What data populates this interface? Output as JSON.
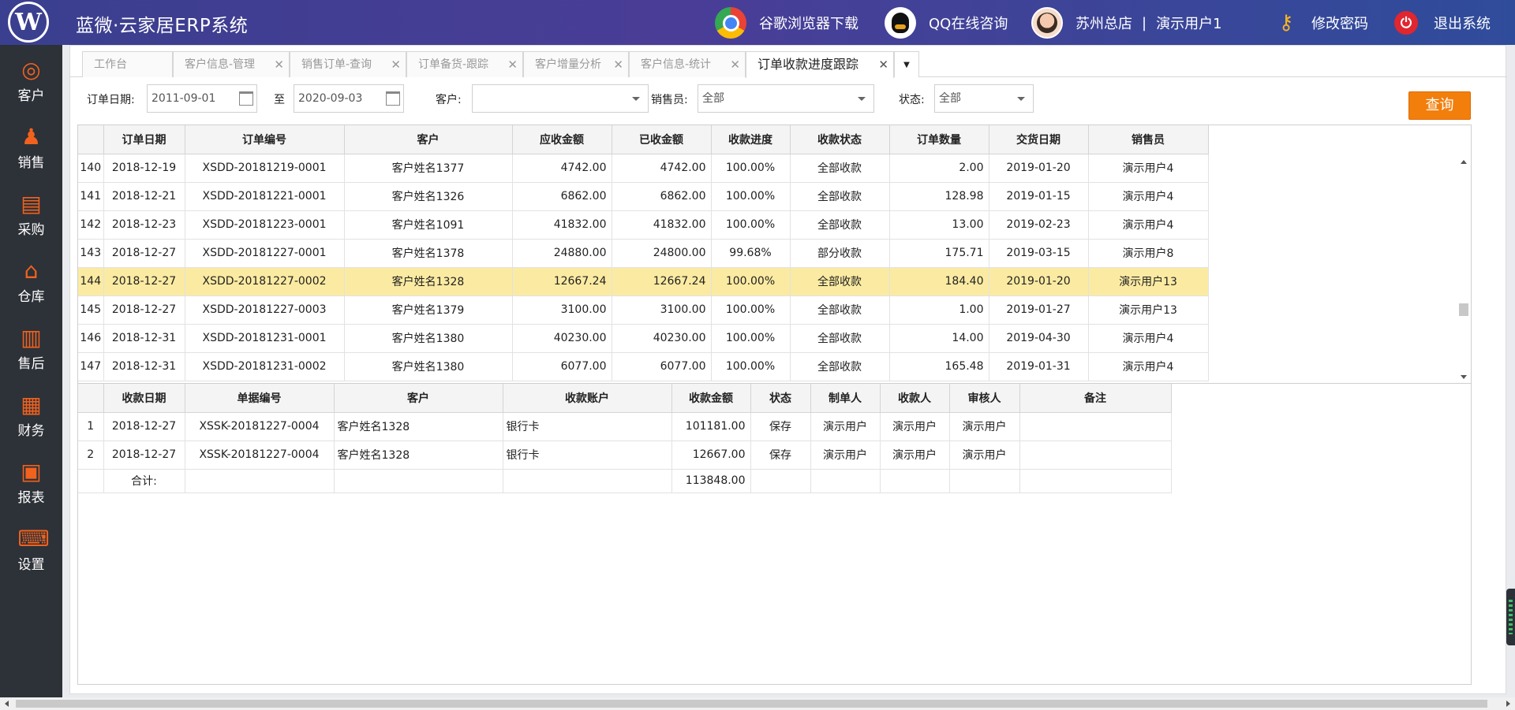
{
  "header": {
    "logo_letter": "W",
    "app_title": "蓝微·云家居ERP系统",
    "chrome_download": "谷歌浏览器下载",
    "qq_consult": "QQ在线咨询",
    "store": "苏州总店",
    "separator": "|",
    "user": "演示用户1",
    "change_password": "修改密码",
    "logout": "退出系统"
  },
  "sidebar": {
    "items": [
      {
        "label": "客户",
        "icon": "compass-icon"
      },
      {
        "label": "销售",
        "icon": "salesperson-icon"
      },
      {
        "label": "采购",
        "icon": "cart-icon"
      },
      {
        "label": "仓库",
        "icon": "warehouse-icon"
      },
      {
        "label": "售后",
        "icon": "bar-chart-icon"
      },
      {
        "label": "财务",
        "icon": "calculator-icon"
      },
      {
        "label": "报表",
        "icon": "report-icon"
      },
      {
        "label": "设置",
        "icon": "keyboard-icon"
      }
    ]
  },
  "tabs": [
    {
      "label": "工作台"
    },
    {
      "label": "客户信息-管理"
    },
    {
      "label": "销售订单-查询"
    },
    {
      "label": "订单备货-跟踪"
    },
    {
      "label": "客户增量分析"
    },
    {
      "label": "客户信息-统计"
    },
    {
      "label": "订单收款进度跟踪"
    }
  ],
  "filters": {
    "order_date_label": "订单日期:",
    "date_from": "2011-09-01",
    "to_label": "至",
    "date_to": "2020-09-03",
    "customer_label": "客户:",
    "customer_value": "",
    "salesperson_label": "销售员:",
    "salesperson_value": "全部",
    "status_label": "状态:",
    "status_value": "全部",
    "query_button": "查询"
  },
  "orders": {
    "columns": [
      "订单日期",
      "订单编号",
      "客户",
      "应收金额",
      "已收金额",
      "收款进度",
      "收款状态",
      "订单数量",
      "交货日期",
      "销售员"
    ],
    "selected_row": 4,
    "rows": [
      {
        "no": "140",
        "date": "2018-12-19",
        "order_no": "XSDD-20181219-0001",
        "customer": "客户姓名1377",
        "receivable": "4742.00",
        "received": "4742.00",
        "progress": "100.00%",
        "status": "全部收款",
        "qty": "2.00",
        "delivery": "2019-01-20",
        "sales": "演示用户4"
      },
      {
        "no": "141",
        "date": "2018-12-21",
        "order_no": "XSDD-20181221-0001",
        "customer": "客户姓名1326",
        "receivable": "6862.00",
        "received": "6862.00",
        "progress": "100.00%",
        "status": "全部收款",
        "qty": "128.98",
        "delivery": "2019-01-15",
        "sales": "演示用户4"
      },
      {
        "no": "142",
        "date": "2018-12-23",
        "order_no": "XSDD-20181223-0001",
        "customer": "客户姓名1091",
        "receivable": "41832.00",
        "received": "41832.00",
        "progress": "100.00%",
        "status": "全部收款",
        "qty": "13.00",
        "delivery": "2019-02-23",
        "sales": "演示用户4"
      },
      {
        "no": "143",
        "date": "2018-12-27",
        "order_no": "XSDD-20181227-0001",
        "customer": "客户姓名1378",
        "receivable": "24880.00",
        "received": "24800.00",
        "progress": "99.68%",
        "status": "部分收款",
        "qty": "175.71",
        "delivery": "2019-03-15",
        "sales": "演示用户8"
      },
      {
        "no": "144",
        "date": "2018-12-27",
        "order_no": "XSDD-20181227-0002",
        "customer": "客户姓名1328",
        "receivable": "12667.24",
        "received": "12667.24",
        "progress": "100.00%",
        "status": "全部收款",
        "qty": "184.40",
        "delivery": "2019-01-20",
        "sales": "演示用户13"
      },
      {
        "no": "145",
        "date": "2018-12-27",
        "order_no": "XSDD-20181227-0003",
        "customer": "客户姓名1379",
        "receivable": "3100.00",
        "received": "3100.00",
        "progress": "100.00%",
        "status": "全部收款",
        "qty": "1.00",
        "delivery": "2019-01-27",
        "sales": "演示用户13"
      },
      {
        "no": "146",
        "date": "2018-12-31",
        "order_no": "XSDD-20181231-0001",
        "customer": "客户姓名1380",
        "receivable": "40230.00",
        "received": "40230.00",
        "progress": "100.00%",
        "status": "全部收款",
        "qty": "14.00",
        "delivery": "2019-04-30",
        "sales": "演示用户4"
      },
      {
        "no": "147",
        "date": "2018-12-31",
        "order_no": "XSDD-20181231-0002",
        "customer": "客户姓名1380",
        "receivable": "6077.00",
        "received": "6077.00",
        "progress": "100.00%",
        "status": "全部收款",
        "qty": "165.48",
        "delivery": "2019-01-31",
        "sales": "演示用户4"
      }
    ]
  },
  "receipts": {
    "columns": [
      "收款日期",
      "单据编号",
      "客户",
      "收款账户",
      "收款金额",
      "状态",
      "制单人",
      "收款人",
      "审核人",
      "备注"
    ],
    "rows": [
      {
        "no": "1",
        "date": "2018-12-27",
        "doc_no": "XSSK-20181227-0004",
        "customer": "客户姓名1328",
        "account": "银行卡",
        "amount": "101181.00",
        "status": "保存",
        "maker": "演示用户",
        "payee": "演示用户",
        "auditor": "演示用户",
        "remark": ""
      },
      {
        "no": "2",
        "date": "2018-12-27",
        "doc_no": "XSSK-20181227-0004",
        "customer": "客户姓名1328",
        "account": "银行卡",
        "amount": "12667.00",
        "status": "保存",
        "maker": "演示用户",
        "payee": "演示用户",
        "auditor": "演示用户",
        "remark": ""
      }
    ],
    "total_label": "合计:",
    "total_amount": "113848.00"
  },
  "colors": {
    "header_bg": "#3a3f8f",
    "sidebar_bg": "#2d3138",
    "sidebar_icon": "#f0621e",
    "query_button": "#f27f0c",
    "selected_row": "#fbeba2"
  }
}
